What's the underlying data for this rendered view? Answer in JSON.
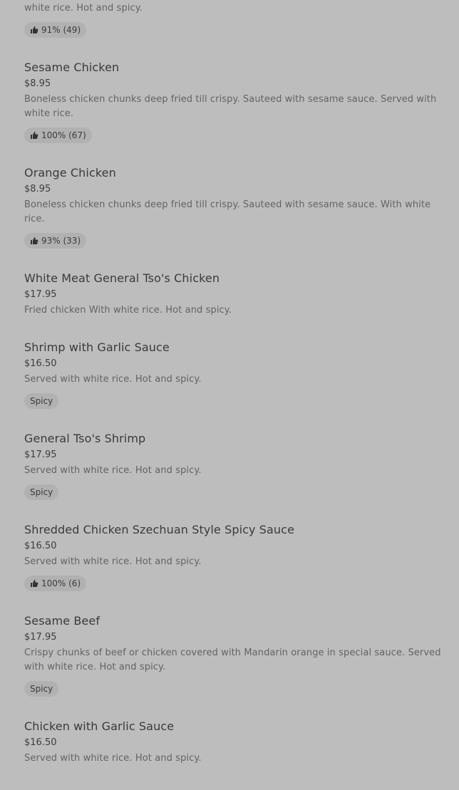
{
  "items": [
    {
      "name": "",
      "price": "",
      "description": "Crispy chunks of chicken seasoned and sauteed with delightly spicy sauce. Served with white rice. Hot and spicy.",
      "badge": {
        "type": "rating",
        "text": "91% (49)"
      }
    },
    {
      "name": "Sesame Chicken",
      "price": "$8.95",
      "description": "Boneless chicken chunks deep fried till crispy. Sauteed with sesame sauce. Served with white rice.",
      "badge": {
        "type": "rating",
        "text": "100% (67)"
      }
    },
    {
      "name": "Orange Chicken",
      "price": "$8.95",
      "description": "Boneless chicken chunks deep fried till crispy. Sauteed with sesame sauce. With white rice.",
      "badge": {
        "type": "rating",
        "text": "93% (33)"
      }
    },
    {
      "name": "White Meat General Tso's Chicken",
      "price": "$17.95",
      "description": "Fried chicken With white rice. Hot and spicy.",
      "badge": null
    },
    {
      "name": "Shrimp with Garlic Sauce",
      "price": "$16.50",
      "description": "Served with white rice. Hot and spicy.",
      "badge": {
        "type": "tag",
        "text": "Spicy"
      }
    },
    {
      "name": "General Tso's Shrimp",
      "price": "$17.95",
      "description": "Served with white rice. Hot and spicy.",
      "badge": {
        "type": "tag",
        "text": "Spicy"
      }
    },
    {
      "name": "Shredded Chicken Szechuan Style Spicy Sauce",
      "price": "$16.50",
      "description": "Served with white rice. Hot and spicy.",
      "badge": {
        "type": "rating",
        "text": "100% (6)"
      }
    },
    {
      "name": "Sesame Beef",
      "price": "$17.95",
      "description": "Crispy chunks of beef or chicken covered with Mandarin orange in special sauce. Served with white rice. Hot and spicy.",
      "badge": {
        "type": "tag",
        "text": "Spicy"
      }
    },
    {
      "name": "Chicken with Garlic Sauce",
      "price": "$16.50",
      "description": "Served with white rice. Hot and spicy.",
      "badge": null
    }
  ]
}
